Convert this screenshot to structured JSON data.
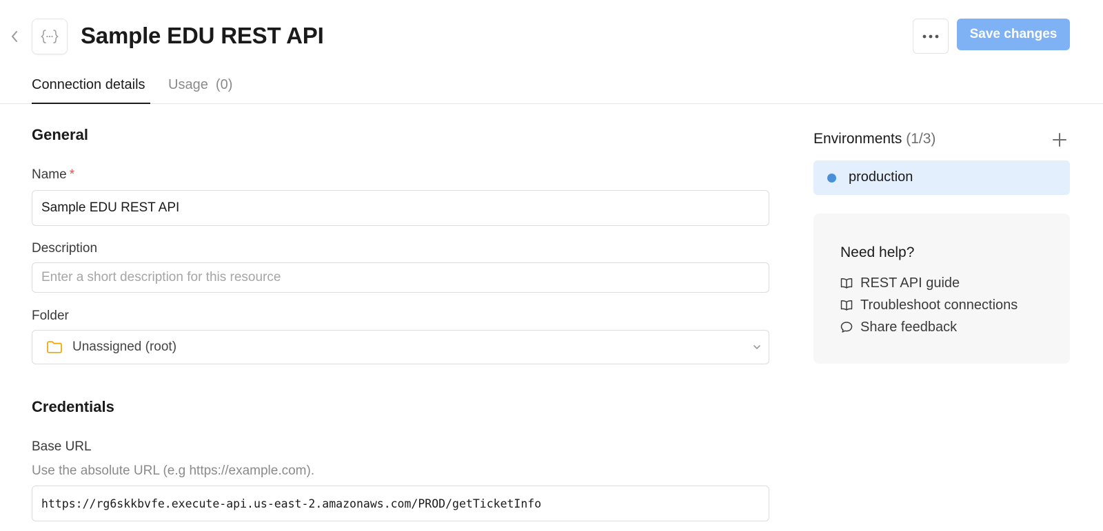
{
  "header": {
    "back_icon": "chevron-left-icon",
    "resource_icon": "curly-braces-icon",
    "title": "Sample EDU REST API",
    "more_icon": "ellipsis-icon",
    "save_label": "Save changes"
  },
  "tabs": [
    {
      "label": "Connection details",
      "active": true
    },
    {
      "label": "Usage  (0)",
      "active": false
    }
  ],
  "general": {
    "title": "General",
    "name": {
      "label": "Name",
      "required_mark": "*",
      "value": "Sample EDU REST API"
    },
    "description": {
      "label": "Description",
      "value": "",
      "placeholder": "Enter a short description for this resource"
    },
    "folder": {
      "label": "Folder",
      "value": "Unassigned (root)",
      "icon": "folder-icon"
    }
  },
  "credentials": {
    "title": "Credentials",
    "base_url": {
      "label": "Base URL",
      "hint": "Use the absolute URL (e.g https://example.com).",
      "value": "https://rg6skkbvfe.execute-api.us-east-2.amazonaws.com/PROD/getTicketInfo"
    }
  },
  "environments": {
    "title": "Environments",
    "count": "(1/3)",
    "items": [
      {
        "label": "production",
        "color": "#4a90d9"
      }
    ]
  },
  "help": {
    "title": "Need help?",
    "links": [
      {
        "label": "REST API guide",
        "icon": "book-open-icon"
      },
      {
        "label": "Troubleshoot connections",
        "icon": "book-open-icon"
      },
      {
        "label": "Share feedback",
        "icon": "message-bubble-icon"
      }
    ]
  },
  "colors": {
    "primary_button": "#7fb2f5",
    "selected_env_bg": "#e3effc",
    "env_dot": "#4a90d9",
    "required": "#e05555",
    "folder_icon": "#f0a500"
  }
}
